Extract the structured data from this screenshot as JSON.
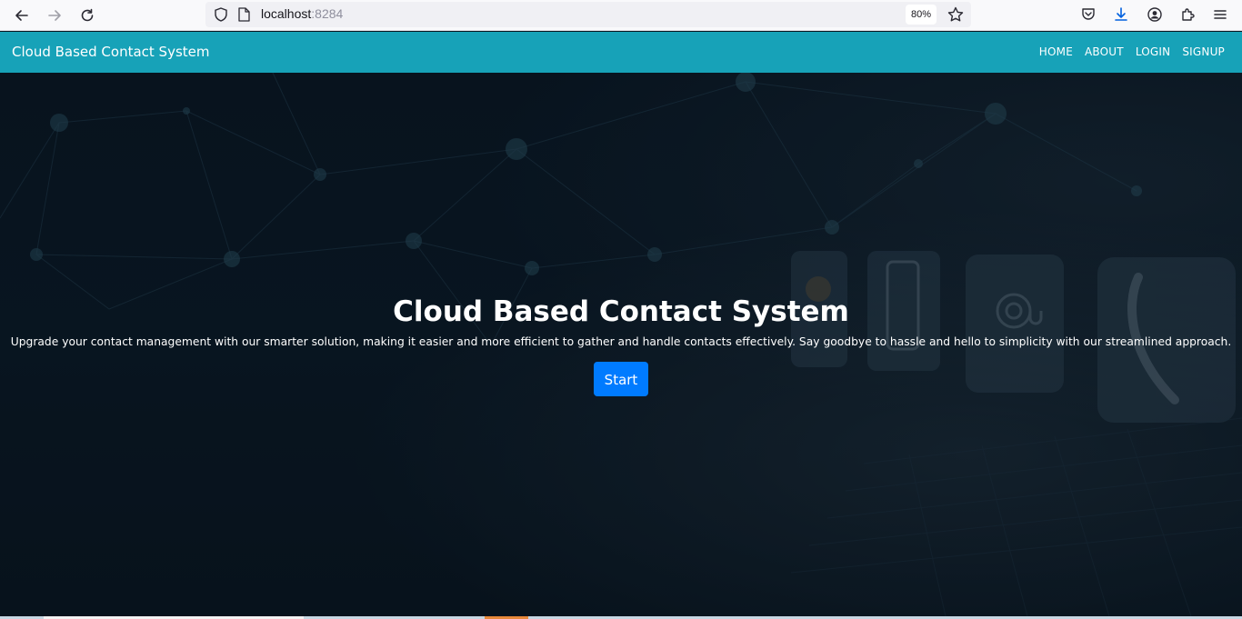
{
  "browser": {
    "url_host": "localhost",
    "url_port": ":8284",
    "zoom": "80%"
  },
  "navbar": {
    "brand": "Cloud Based Contact System",
    "links": [
      "HOME",
      "ABOUT",
      "LOGIN",
      "SIGNUP"
    ]
  },
  "hero": {
    "title": "Cloud Based Contact System",
    "text": "Upgrade your contact management with our smarter solution, making it easier and more efficient to gather and handle contacts effectively. Say goodbye to hassle and hello to simplicity with our streamlined approach.",
    "button": "Start"
  },
  "colors": {
    "navbar_bg": "#17a2b8",
    "button_bg": "#007bff",
    "hero_bg": "#0b1a26"
  }
}
